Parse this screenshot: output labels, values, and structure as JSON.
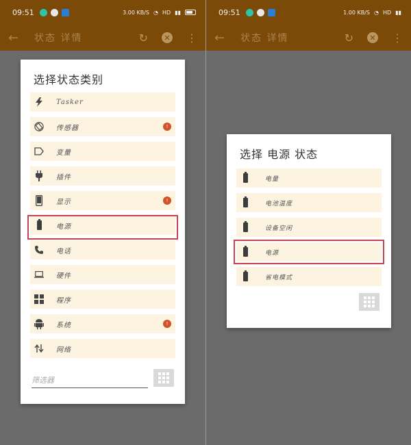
{
  "left": {
    "status": {
      "time": "09:51",
      "data_rate": "3.00 KB/S",
      "network": "HD"
    },
    "appbar": {
      "title": "状态 详情"
    },
    "dialog": {
      "title": "选择状态类别",
      "items": [
        {
          "label": "Tasker",
          "icon": "lightning-icon",
          "badge": ""
        },
        {
          "label": "传感器",
          "icon": "rotate-icon",
          "badge": "!"
        },
        {
          "label": "变量",
          "icon": "tag-icon",
          "badge": ""
        },
        {
          "label": "插件",
          "icon": "plug-icon",
          "badge": ""
        },
        {
          "label": "显示",
          "icon": "phone-icon",
          "badge": "!"
        },
        {
          "label": "电源",
          "icon": "battery-icon",
          "badge": ""
        },
        {
          "label": "电话",
          "icon": "call-icon",
          "badge": ""
        },
        {
          "label": "硬件",
          "icon": "laptop-icon",
          "badge": ""
        },
        {
          "label": "程序",
          "icon": "apps-icon",
          "badge": ""
        },
        {
          "label": "系统",
          "icon": "android-icon",
          "badge": "!"
        },
        {
          "label": "网络",
          "icon": "sync-arrows-icon",
          "badge": ""
        }
      ],
      "filter_placeholder": "筛选器"
    }
  },
  "right": {
    "status": {
      "time": "09:51",
      "data_rate": "1.00 KB/S",
      "network": "HD"
    },
    "appbar": {
      "title": "状态 详情"
    },
    "dialog": {
      "title": "选择 电源 状态",
      "items": [
        {
          "label": "电量",
          "icon": "battery-icon"
        },
        {
          "label": "电池温度",
          "icon": "battery-icon"
        },
        {
          "label": "设备空闲",
          "icon": "battery-icon"
        },
        {
          "label": "电源",
          "icon": "battery-icon"
        },
        {
          "label": "省电模式",
          "icon": "battery-icon"
        }
      ]
    }
  },
  "colors": {
    "appbar": "#7c4a08",
    "item_bg": "#fcf3e1",
    "highlight": "#c94050",
    "badge": "#d2522a",
    "backdrop": "#6b6b6b"
  }
}
